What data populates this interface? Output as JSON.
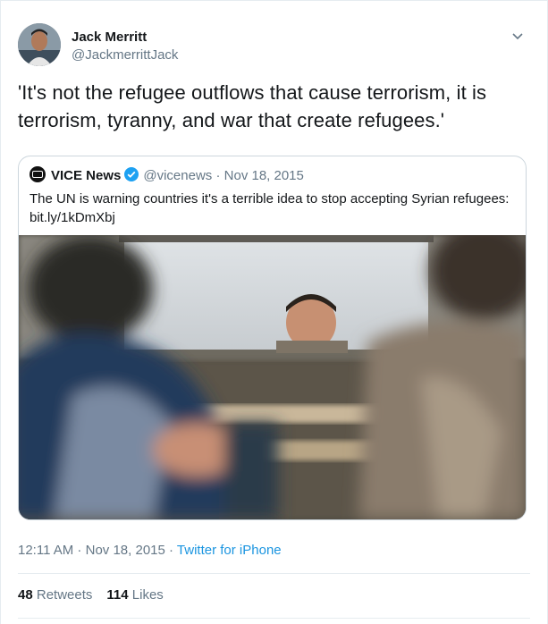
{
  "author": {
    "display_name": "Jack Merritt",
    "handle": "@JackmerrittJack",
    "avatar_icon": "profile-photo"
  },
  "tweet": {
    "text": "'It's not the refugee outflows that cause terrorism, it is terrorism, tyranny, and war that create refugees.'"
  },
  "quoted_tweet": {
    "display_name": "VICE News",
    "verified_icon": "verified-badge-icon",
    "handle": "@vicenews",
    "separator": " · ",
    "date": "Nov 18, 2015",
    "text": "The UN is warning countries it's a terrible idea to stop accepting Syrian refugees: bit.ly/1kDmXbj",
    "media_icon": "photo-child-at-window"
  },
  "meta": {
    "time": "12:11 AM",
    "separator1": " · ",
    "date": "Nov 18, 2015",
    "separator2": " · ",
    "source": "Twitter for iPhone"
  },
  "stats": {
    "retweets_count": "48",
    "retweets_label": "Retweets",
    "likes_count": "114",
    "likes_label": "Likes"
  },
  "colors": {
    "link": "#1b95e0",
    "secondary_text": "#657786",
    "primary_text": "#14171a",
    "verified": "#1da1f2",
    "border": "#e6ecf0"
  }
}
